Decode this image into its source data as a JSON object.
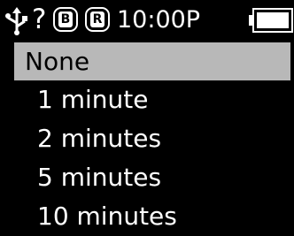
{
  "status_bar": {
    "usb_icon": "usb-icon",
    "help_glyph": "?",
    "badge_b": "B",
    "badge_r": "R",
    "time": "10:00P",
    "battery_icon": "battery-full-icon"
  },
  "menu": {
    "items": [
      {
        "marker": "*",
        "label": "None",
        "selected": true
      },
      {
        "marker": "",
        "label": "1 minute",
        "selected": false
      },
      {
        "marker": "",
        "label": "2 minutes",
        "selected": false
      },
      {
        "marker": "",
        "label": "5 minutes",
        "selected": false
      },
      {
        "marker": "",
        "label": "10 minutes",
        "selected": false
      }
    ]
  },
  "colors": {
    "background": "#000000",
    "foreground": "#ffffff",
    "selection": "#b8b8b8"
  }
}
